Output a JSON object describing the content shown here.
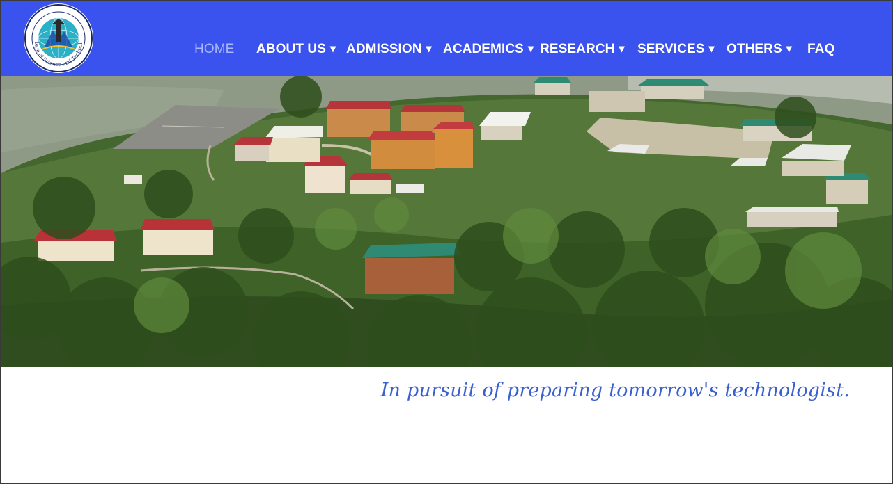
{
  "header": {
    "logo": {
      "name": "college-logo",
      "text": "College of Science and Technology",
      "script_text": "ཚན་རིག་དང་འཕྲུལ་རིག་མཐོ་རིམ་སློབ་གྲྭ"
    },
    "nav": [
      {
        "label": "HOME",
        "active": true,
        "dropdown": false
      },
      {
        "label": "ABOUT US",
        "active": false,
        "dropdown": true
      },
      {
        "label": "ADMISSION",
        "active": false,
        "dropdown": true
      },
      {
        "label": "ACADEMICS",
        "active": false,
        "dropdown": true
      },
      {
        "label": "RESEARCH",
        "active": false,
        "dropdown": true
      },
      {
        "label": "SERVICES",
        "active": false,
        "dropdown": true
      },
      {
        "label": "OTHERS",
        "active": false,
        "dropdown": true
      },
      {
        "label": "FAQ",
        "active": false,
        "dropdown": false
      }
    ],
    "caret_glyph": "▾"
  },
  "hero": {
    "image": "aerial-campus-photo"
  },
  "tagline": "In pursuit of preparing tomorrow's technologist.",
  "colors": {
    "header_bg": "#3a52ee",
    "nav_text": "#ffffff",
    "nav_active": "#a9b8ff",
    "tagline": "#3a5fcf"
  }
}
